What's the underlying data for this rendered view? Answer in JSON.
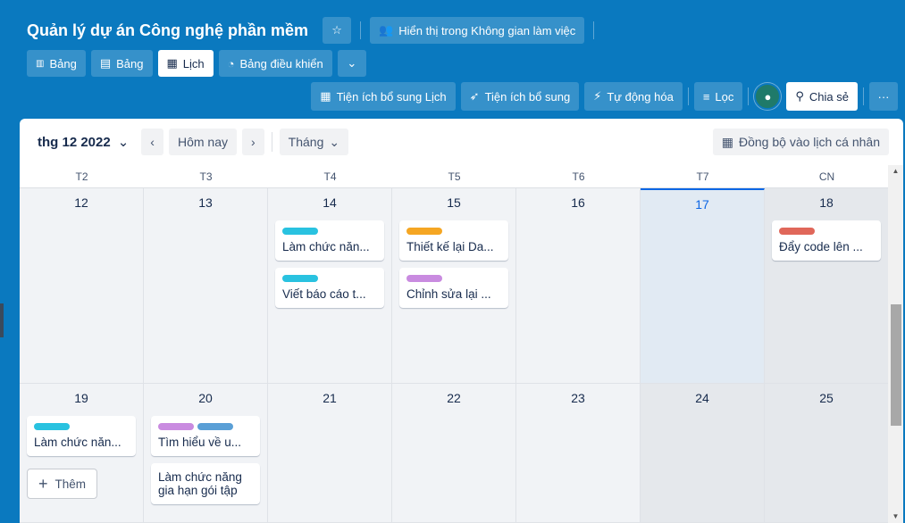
{
  "header": {
    "board_title": "Quản lý dự án Công nghệ phần mềm",
    "workspace_visibility": "Hiển thị trong Không gian làm việc"
  },
  "views": [
    {
      "label": "Bảng",
      "icon": "roadmap-icon"
    },
    {
      "label": "Bảng",
      "icon": "table-icon"
    },
    {
      "label": "Lịch",
      "icon": "calendar-icon",
      "active": true
    },
    {
      "label": "Bảng điều khiển",
      "icon": "dashboard-icon"
    }
  ],
  "toolbar": {
    "calendar_powerup": "Tiện ích bổ sung Lịch",
    "powerups": "Tiện ích bổ sung",
    "automation": "Tự động hóa",
    "filter": "Lọc",
    "share": "Chia sẻ"
  },
  "calendar": {
    "month": "thg 12 2022",
    "today": "Hôm nay",
    "view_mode": "Tháng",
    "sync": "Đồng bộ vào lịch cá nhân",
    "weekdays": [
      "T2",
      "T3",
      "T4",
      "T5",
      "T6",
      "T7",
      "CN"
    ],
    "add_label": "Thêm",
    "week1": [
      {
        "day": "12",
        "cards": []
      },
      {
        "day": "13",
        "cards": []
      },
      {
        "day": "14",
        "cards": [
          {
            "text": "Làm chức năn...",
            "labels": [
              "#29c2e0"
            ]
          },
          {
            "text": "Viết báo cáo t...",
            "labels": [
              "#29c2e0"
            ]
          }
        ]
      },
      {
        "day": "15",
        "cards": [
          {
            "text": "Thiết kế lại Da...",
            "labels": [
              "#f5a623"
            ]
          },
          {
            "text": "Chỉnh sửa lại ...",
            "labels": [
              "#c98be0"
            ]
          }
        ]
      },
      {
        "day": "16",
        "cards": []
      },
      {
        "day": "17",
        "cards": [],
        "today": true
      },
      {
        "day": "18",
        "cards": [
          {
            "text": "Đẩy code lên ...",
            "labels": [
              "#e0675a"
            ]
          }
        ]
      }
    ],
    "week2": [
      {
        "day": "19",
        "cards": [
          {
            "text": "Làm chức năn...",
            "labels": [
              "#29c2e0"
            ]
          }
        ]
      },
      {
        "day": "20",
        "cards": [
          {
            "text": "Tìm hiểu về u...",
            "labels": [
              "#c98be0",
              "#5a9fd6"
            ]
          },
          {
            "text": "Làm chức năng gia hạn gói tập",
            "labels": [],
            "wrap": true
          }
        ]
      },
      {
        "day": "21",
        "cards": []
      },
      {
        "day": "22",
        "cards": []
      },
      {
        "day": "23",
        "cards": []
      },
      {
        "day": "24",
        "cards": []
      },
      {
        "day": "25",
        "cards": []
      }
    ]
  }
}
